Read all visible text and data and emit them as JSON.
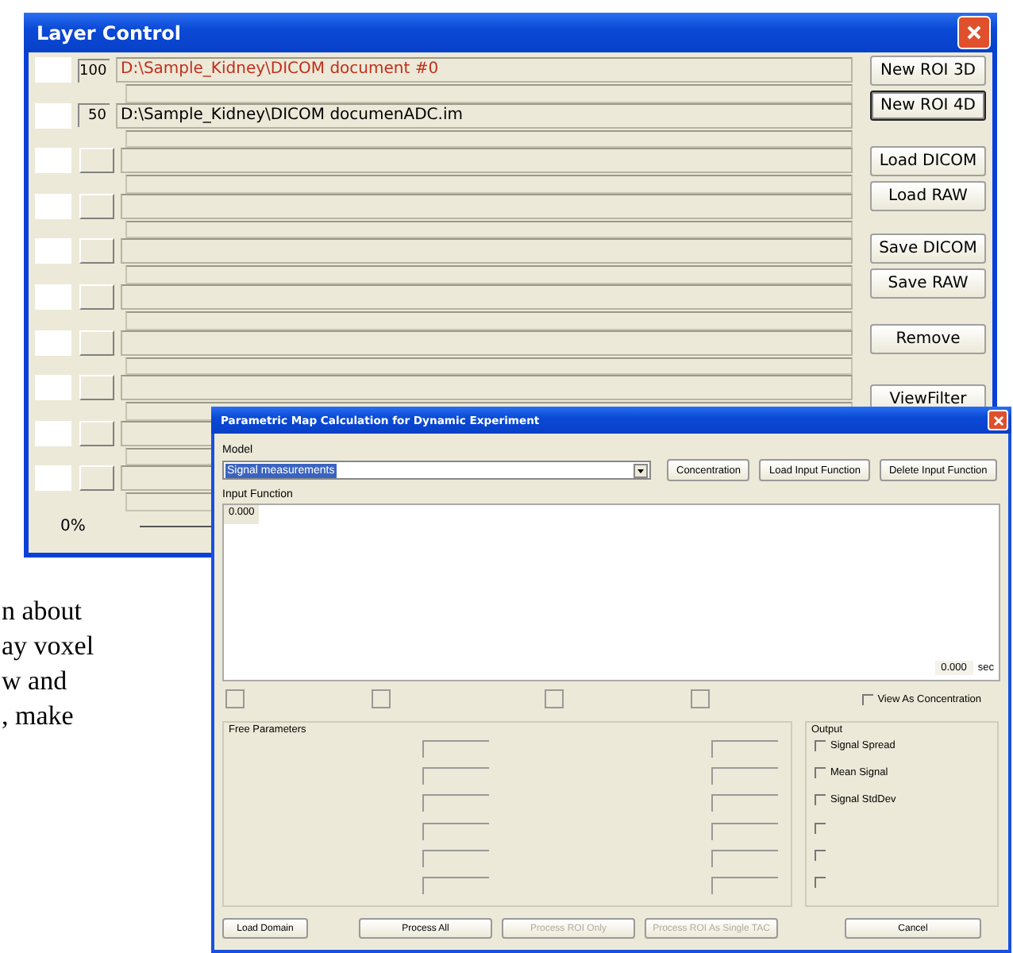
{
  "background_text": [
    "n about",
    "ay voxel",
    "w and",
    ", make"
  ],
  "layer_window": {
    "title": "Layer Control",
    "layers": [
      {
        "kind": "value",
        "value": "100",
        "path": "D:\\Sample_Kidney\\DICOM document #0",
        "selected": true
      },
      {
        "kind": "value",
        "value": "50",
        "path": "D:\\Sample_Kidney\\DICOM documenADC.im",
        "selected": false
      },
      {
        "kind": "empty"
      },
      {
        "kind": "empty"
      },
      {
        "kind": "empty"
      },
      {
        "kind": "empty"
      },
      {
        "kind": "empty"
      },
      {
        "kind": "empty"
      },
      {
        "kind": "empty"
      },
      {
        "kind": "empty"
      }
    ],
    "button_groups": [
      [
        {
          "label": "New ROI 3D",
          "focused": false
        },
        {
          "label": "New ROI 4D",
          "focused": true
        }
      ],
      [
        {
          "label": "Load DICOM",
          "focused": false
        },
        {
          "label": "Load RAW",
          "focused": false
        }
      ],
      [
        {
          "label": "Save DICOM",
          "focused": false
        },
        {
          "label": "Save RAW",
          "focused": false
        }
      ],
      [
        {
          "label": "Remove",
          "focused": false
        }
      ],
      [
        {
          "label": "ViewFilter",
          "focused": false
        }
      ]
    ],
    "progress": {
      "label": "0%",
      "level": 0
    }
  },
  "dialog": {
    "title": "Parametric Map Calculation for Dynamic Experiment",
    "model_label": "Model",
    "model_value": "Signal measurements",
    "top_buttons": [
      "Concentration",
      "Load Input Function",
      "Delete Input Function"
    ],
    "input_function_label": "Input Function",
    "graph_top_value": "0.000",
    "time_value": "0.000",
    "time_unit": "sec",
    "view_as_concentration": {
      "label": "View As Concentration",
      "checked": false
    },
    "free_parameters": {
      "title": "Free Parameters"
    },
    "output": {
      "title": "Output",
      "options": [
        {
          "label": "Signal Spread",
          "checked": false
        },
        {
          "label": "Mean Signal",
          "checked": false
        },
        {
          "label": "Signal StdDev",
          "checked": false
        },
        {
          "checked": false
        },
        {
          "checked": false
        },
        {
          "checked": false
        }
      ]
    },
    "bottom_buttons": [
      {
        "label": "Load Domain",
        "disabled": false
      },
      {
        "label": "Process All",
        "disabled": false
      },
      {
        "label": "Process ROI Only",
        "disabled": true
      },
      {
        "label": "Process ROI As Single TAC",
        "disabled": true
      },
      {
        "label": "Cancel",
        "disabled": false
      }
    ]
  }
}
